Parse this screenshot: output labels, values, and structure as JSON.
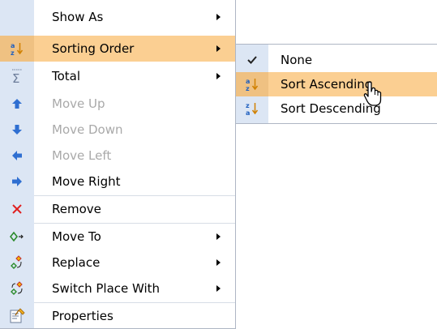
{
  "main_menu": {
    "items": [
      {
        "label": "Show As",
        "icon": "none",
        "enabled": true,
        "submenu": true
      },
      {
        "label": "Sorting Order",
        "icon": "sort-az-icon",
        "enabled": true,
        "submenu": true,
        "highlighted": true
      },
      {
        "label": "Total",
        "icon": "sigma-icon",
        "enabled": true,
        "submenu": true
      },
      {
        "label": "Move Up",
        "icon": "arrow-up-icon",
        "enabled": false
      },
      {
        "label": "Move Down",
        "icon": "arrow-down-icon",
        "enabled": false
      },
      {
        "label": "Move Left",
        "icon": "arrow-left-icon",
        "enabled": false
      },
      {
        "label": "Move Right",
        "icon": "arrow-right-icon",
        "enabled": true
      },
      {
        "label": "Remove",
        "icon": "red-x-icon",
        "enabled": true
      },
      {
        "label": "Move To",
        "icon": "move-to-icon",
        "enabled": true,
        "submenu": true
      },
      {
        "label": "Replace",
        "icon": "replace-icon",
        "enabled": true,
        "submenu": true
      },
      {
        "label": "Switch Place With",
        "icon": "switch-place-icon",
        "enabled": true,
        "submenu": true
      },
      {
        "label": "Properties",
        "icon": "properties-icon",
        "enabled": true
      }
    ]
  },
  "sort_submenu": {
    "items": [
      {
        "label": "None",
        "icon": "checkmark-icon",
        "checked": true
      },
      {
        "label": "Sort Ascending",
        "icon": "sort-az-icon",
        "highlighted": true
      },
      {
        "label": "Sort Descending",
        "icon": "sort-za-icon"
      }
    ]
  },
  "colors": {
    "highlight": "#fbcf92",
    "gutter": "#dce6f4",
    "disabled_text": "#a9a9a9",
    "arrow_blue": "#2f6fd1",
    "remove_red": "#e02020"
  }
}
